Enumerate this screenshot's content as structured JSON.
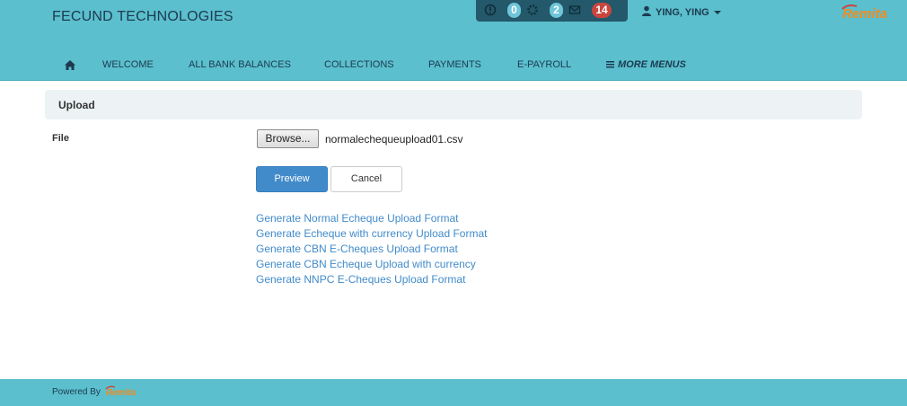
{
  "header": {
    "brand": "FECUND TECHNOLOGIES",
    "notifications": [
      {
        "icon": "alert-circle-icon",
        "count": "0",
        "color": "#6fc5d9"
      },
      {
        "icon": "gear-icon",
        "count": "2",
        "color": "#6fc5d9"
      },
      {
        "icon": "envelope-icon",
        "count": "14",
        "color": "#c9463f"
      }
    ],
    "user": {
      "name": "YING, YING",
      "icon": "user-icon"
    },
    "logo": "Remita"
  },
  "nav": {
    "home_icon": "home-icon",
    "items": [
      {
        "label": "WELCOME"
      },
      {
        "label": "ALL BANK BALANCES"
      },
      {
        "label": "COLLECTIONS"
      },
      {
        "label": "PAYMENTS"
      },
      {
        "label": "E-PAYROLL"
      },
      {
        "label": "MORE MENUS",
        "icon": "menu-bars-icon"
      }
    ]
  },
  "panel": {
    "title": "Upload",
    "file_label": "File",
    "browse_label": "Browse...",
    "file_name": "normalechequeupload01.csv",
    "preview_label": "Preview",
    "cancel_label": "Cancel",
    "links": [
      "Generate Normal Echeque Upload Format",
      "Generate Echeque with currency Upload Format",
      "Generate CBN E-Cheques Upload Format",
      "Generate CBN Echeque Upload with currency",
      "Generate NNPC E-Cheques Upload Format"
    ]
  },
  "footer": {
    "powered_by": "Powered By",
    "logo": "Remita"
  },
  "colors": {
    "header_bg": "#5bbfcd",
    "notif_bg": "#24586b",
    "link": "#428bca",
    "primary_button": "#428bca",
    "logo_orange": "#f28c1e"
  }
}
